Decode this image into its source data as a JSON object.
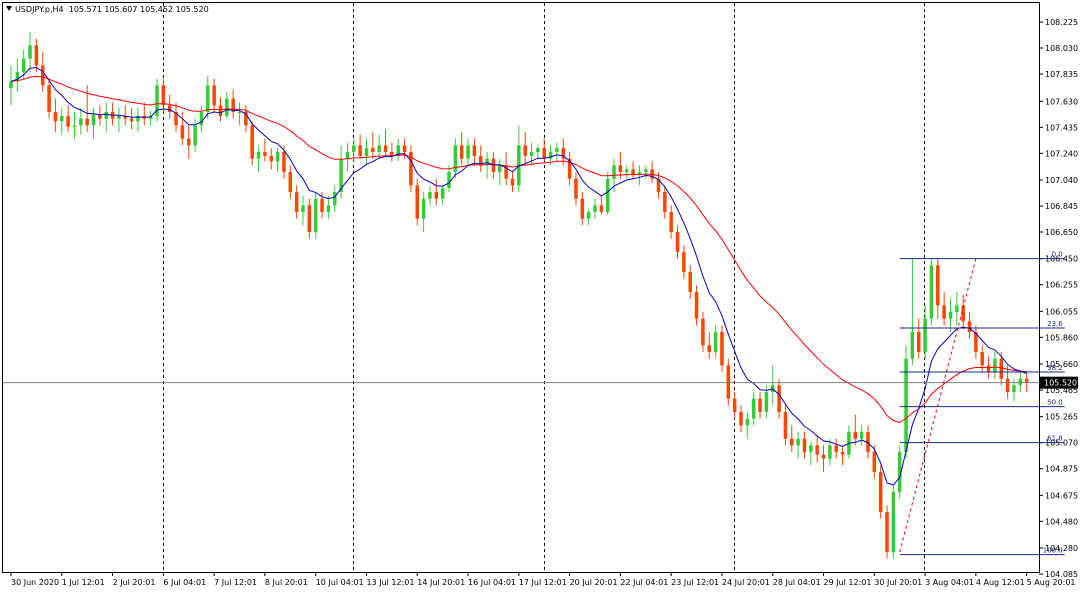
{
  "header": {
    "symbol": "USDJPY.p,H4",
    "ohlc": "105.571 105.607 105.452 105.520"
  },
  "colors": {
    "bull": "#32cd32",
    "bear": "#ff4500",
    "ma_fast": "#0000cc",
    "ma_slow": "#ff0000",
    "fib": "#1a2a8c",
    "trend": "#ff0000",
    "grid_separator": "#000000",
    "bid_line": "#808080",
    "price_tag_bg": "#000000"
  },
  "chart_data": {
    "type": "candlestick",
    "y_ticks": [
      "108.225",
      "108.030",
      "107.835",
      "107.630",
      "107.435",
      "107.240",
      "107.040",
      "106.845",
      "106.650",
      "106.450",
      "106.255",
      "106.055",
      "105.860",
      "105.660",
      "105.465",
      "105.265",
      "105.070",
      "104.875",
      "104.675",
      "104.480",
      "104.280",
      "104.085"
    ],
    "ylim": [
      104.05,
      108.28
    ],
    "x_ticks": [
      "30 Jun 2020",
      "1 Jul 12:01",
      "2 Jul 20:01",
      "6 Jul 04:01",
      "7 Jul 12:01",
      "8 Jul 20:01",
      "10 Jul 04:01",
      "13 Jul 12:01",
      "14 Jul 20:01",
      "16 Jul 04:01",
      "17 Jul 12:01",
      "20 Jul 20:01",
      "22 Jul 04:01",
      "23 Jul 12:01",
      "24 Jul 20:01",
      "28 Jul 04:01",
      "29 Jul 12:01",
      "30 Jul 20:01",
      "3 Aug 04:01",
      "4 Aug 12:01",
      "5 Aug 20:01"
    ],
    "x_tick_index": [
      0,
      8,
      16,
      24,
      32,
      40,
      48,
      56,
      64,
      72,
      80,
      88,
      96,
      104,
      112,
      120,
      128,
      136,
      144,
      152,
      160
    ],
    "day_separator_index": [
      23,
      53,
      83,
      113,
      143
    ],
    "current_price": "105.520",
    "candles": [
      [
        107.73,
        107.9,
        107.6,
        107.78
      ],
      [
        107.78,
        107.95,
        107.7,
        107.85
      ],
      [
        107.85,
        108.02,
        107.8,
        107.95
      ],
      [
        107.95,
        108.15,
        107.85,
        108.05
      ],
      [
        108.05,
        108.1,
        107.85,
        107.9
      ],
      [
        107.9,
        108.0,
        107.7,
        107.75
      ],
      [
        107.75,
        107.8,
        107.5,
        107.55
      ],
      [
        107.55,
        107.65,
        107.4,
        107.48
      ],
      [
        107.48,
        107.58,
        107.38,
        107.52
      ],
      [
        107.52,
        107.6,
        107.4,
        107.44
      ],
      [
        107.44,
        107.55,
        107.35,
        107.45
      ],
      [
        107.45,
        107.58,
        107.38,
        107.5
      ],
      [
        107.5,
        107.75,
        107.4,
        107.45
      ],
      [
        107.45,
        107.58,
        107.35,
        107.53
      ],
      [
        107.53,
        107.6,
        107.45,
        107.5
      ],
      [
        107.5,
        107.62,
        107.4,
        107.55
      ],
      [
        107.55,
        107.62,
        107.45,
        107.5
      ],
      [
        107.5,
        107.58,
        107.4,
        107.52
      ],
      [
        107.52,
        107.6,
        107.45,
        107.5
      ],
      [
        107.5,
        107.58,
        107.42,
        107.48
      ],
      [
        107.48,
        107.58,
        107.4,
        107.52
      ],
      [
        107.52,
        107.62,
        107.45,
        107.5
      ],
      [
        107.5,
        107.56,
        107.45,
        107.52
      ],
      [
        107.52,
        107.8,
        107.48,
        107.75
      ],
      [
        107.75,
        107.8,
        107.55,
        107.6
      ],
      [
        107.6,
        107.68,
        107.5,
        107.55
      ],
      [
        107.55,
        107.62,
        107.4,
        107.45
      ],
      [
        107.45,
        107.55,
        107.3,
        107.35
      ],
      [
        107.35,
        107.45,
        107.2,
        107.3
      ],
      [
        107.3,
        107.5,
        107.25,
        107.45
      ],
      [
        107.45,
        107.6,
        107.4,
        107.55
      ],
      [
        107.55,
        107.82,
        107.5,
        107.75
      ],
      [
        107.75,
        107.8,
        107.55,
        107.6
      ],
      [
        107.6,
        107.66,
        107.48,
        107.52
      ],
      [
        107.52,
        107.7,
        107.5,
        107.65
      ],
      [
        107.65,
        107.72,
        107.5,
        107.55
      ],
      [
        107.55,
        107.62,
        107.45,
        107.55
      ],
      [
        107.55,
        107.6,
        107.4,
        107.45
      ],
      [
        107.45,
        107.48,
        107.15,
        107.2
      ],
      [
        107.2,
        107.3,
        107.1,
        107.25
      ],
      [
        107.25,
        107.35,
        107.18,
        107.22
      ],
      [
        107.22,
        107.28,
        107.12,
        107.18
      ],
      [
        107.18,
        107.28,
        107.1,
        107.25
      ],
      [
        107.25,
        107.3,
        107.05,
        107.1
      ],
      [
        107.1,
        107.15,
        106.9,
        106.95
      ],
      [
        106.95,
        107.0,
        106.75,
        106.8
      ],
      [
        106.8,
        106.92,
        106.7,
        106.85
      ],
      [
        106.85,
        106.9,
        106.6,
        106.65
      ],
      [
        106.65,
        106.95,
        106.6,
        106.9
      ],
      [
        106.9,
        106.95,
        106.75,
        106.8
      ],
      [
        106.8,
        106.92,
        106.75,
        106.85
      ],
      [
        106.85,
        107.0,
        106.8,
        106.95
      ],
      [
        106.95,
        107.3,
        106.9,
        107.2
      ],
      [
        107.2,
        107.32,
        107.1,
        107.25
      ],
      [
        107.25,
        107.35,
        107.18,
        107.3
      ],
      [
        107.3,
        107.38,
        107.2,
        107.22
      ],
      [
        107.22,
        107.35,
        107.15,
        107.28
      ],
      [
        107.28,
        107.4,
        107.2,
        107.25
      ],
      [
        107.25,
        107.38,
        107.2,
        107.3
      ],
      [
        107.3,
        107.42,
        107.22,
        107.25
      ],
      [
        107.25,
        107.32,
        107.18,
        107.22
      ],
      [
        107.22,
        107.35,
        107.18,
        107.3
      ],
      [
        107.3,
        107.35,
        107.2,
        107.25
      ],
      [
        107.25,
        107.3,
        106.95,
        107.0
      ],
      [
        107.0,
        107.05,
        106.7,
        106.75
      ],
      [
        106.75,
        106.95,
        106.65,
        106.9
      ],
      [
        106.9,
        107.0,
        106.85,
        106.95
      ],
      [
        106.95,
        107.05,
        106.85,
        106.9
      ],
      [
        106.9,
        107.0,
        106.85,
        106.98
      ],
      [
        106.98,
        107.15,
        106.95,
        107.1
      ],
      [
        107.1,
        107.35,
        107.05,
        107.3
      ],
      [
        107.3,
        107.4,
        107.15,
        107.2
      ],
      [
        107.2,
        107.35,
        107.15,
        107.3
      ],
      [
        107.3,
        107.35,
        107.15,
        107.22
      ],
      [
        107.22,
        107.3,
        107.1,
        107.15
      ],
      [
        107.15,
        107.25,
        107.05,
        107.2
      ],
      [
        107.2,
        107.25,
        107.05,
        107.1
      ],
      [
        107.1,
        107.2,
        107.0,
        107.15
      ],
      [
        107.15,
        107.25,
        107.0,
        107.05
      ],
      [
        107.05,
        107.1,
        106.95,
        107.0
      ],
      [
        107.0,
        107.45,
        106.95,
        107.3
      ],
      [
        107.3,
        107.4,
        107.15,
        107.22
      ],
      [
        107.22,
        107.32,
        107.15,
        107.25
      ],
      [
        107.25,
        107.3,
        107.2,
        107.28
      ],
      [
        107.28,
        107.35,
        107.18,
        107.2
      ],
      [
        107.2,
        107.3,
        107.15,
        107.25
      ],
      [
        107.25,
        107.32,
        107.18,
        107.28
      ],
      [
        107.28,
        107.35,
        107.15,
        107.2
      ],
      [
        107.2,
        107.25,
        107.0,
        107.05
      ],
      [
        107.05,
        107.1,
        106.85,
        106.9
      ],
      [
        106.9,
        106.95,
        106.7,
        106.75
      ],
      [
        106.75,
        106.82,
        106.7,
        106.8
      ],
      [
        106.8,
        106.9,
        106.75,
        106.85
      ],
      [
        106.85,
        106.92,
        106.78,
        106.8
      ],
      [
        106.8,
        107.1,
        106.78,
        107.05
      ],
      [
        107.05,
        107.2,
        106.95,
        107.15
      ],
      [
        107.15,
        107.25,
        107.05,
        107.1
      ],
      [
        107.1,
        107.15,
        107.05,
        107.12
      ],
      [
        107.12,
        107.18,
        107.05,
        107.08
      ],
      [
        107.08,
        107.15,
        107.0,
        107.1
      ],
      [
        107.1,
        107.15,
        107.05,
        107.12
      ],
      [
        107.12,
        107.18,
        107.02,
        107.05
      ],
      [
        107.05,
        107.1,
        106.9,
        106.95
      ],
      [
        106.95,
        107.0,
        106.75,
        106.8
      ],
      [
        106.8,
        106.85,
        106.6,
        106.65
      ],
      [
        106.65,
        106.7,
        106.45,
        106.5
      ],
      [
        106.5,
        106.55,
        106.3,
        106.35
      ],
      [
        106.35,
        106.4,
        106.15,
        106.2
      ],
      [
        106.2,
        106.25,
        105.95,
        106.0
      ],
      [
        106.0,
        106.05,
        105.75,
        105.8
      ],
      [
        105.8,
        105.9,
        105.7,
        105.75
      ],
      [
        105.75,
        105.95,
        105.7,
        105.9
      ],
      [
        105.9,
        105.95,
        105.6,
        105.65
      ],
      [
        105.65,
        105.7,
        105.35,
        105.4
      ],
      [
        105.4,
        105.45,
        105.25,
        105.3
      ],
      [
        105.3,
        105.35,
        105.15,
        105.2
      ],
      [
        105.2,
        105.3,
        105.1,
        105.25
      ],
      [
        105.25,
        105.45,
        105.2,
        105.4
      ],
      [
        105.4,
        105.45,
        105.25,
        105.3
      ],
      [
        105.3,
        105.5,
        105.25,
        105.45
      ],
      [
        105.45,
        105.65,
        105.35,
        105.5
      ],
      [
        105.5,
        105.55,
        105.25,
        105.3
      ],
      [
        105.3,
        105.35,
        105.05,
        105.1
      ],
      [
        105.1,
        105.2,
        105.0,
        105.05
      ],
      [
        105.05,
        105.15,
        104.95,
        105.1
      ],
      [
        105.1,
        105.15,
        104.95,
        105.0
      ],
      [
        105.0,
        105.08,
        104.9,
        105.05
      ],
      [
        105.05,
        105.12,
        104.92,
        104.98
      ],
      [
        104.98,
        105.05,
        104.85,
        104.95
      ],
      [
        104.95,
        105.1,
        104.9,
        105.05
      ],
      [
        105.05,
        105.1,
        104.95,
        105.0
      ],
      [
        105.0,
        105.05,
        104.9,
        104.98
      ],
      [
        104.98,
        105.2,
        104.95,
        105.15
      ],
      [
        105.15,
        105.28,
        105.05,
        105.1
      ],
      [
        105.1,
        105.2,
        105.05,
        105.15
      ],
      [
        105.15,
        105.2,
        104.95,
        105.0
      ],
      [
        105.0,
        105.05,
        104.8,
        104.85
      ],
      [
        104.85,
        104.9,
        104.5,
        104.55
      ],
      [
        104.55,
        104.6,
        104.2,
        104.25
      ],
      [
        104.25,
        104.75,
        104.2,
        104.7
      ],
      [
        104.7,
        105.05,
        104.65,
        105.0
      ],
      [
        105.0,
        105.8,
        104.95,
        105.7
      ],
      [
        105.7,
        106.45,
        105.65,
        105.9
      ],
      [
        105.9,
        106.0,
        105.7,
        105.75
      ],
      [
        105.75,
        106.1,
        105.7,
        106.0
      ],
      [
        106.0,
        106.45,
        105.95,
        106.4
      ],
      [
        106.4,
        106.45,
        106.0,
        106.1
      ],
      [
        106.1,
        106.2,
        105.95,
        106.0
      ],
      [
        106.0,
        106.15,
        105.9,
        106.05
      ],
      [
        106.05,
        106.2,
        105.95,
        106.1
      ],
      [
        106.1,
        106.18,
        105.92,
        105.98
      ],
      [
        105.98,
        106.05,
        105.85,
        105.9
      ],
      [
        105.9,
        105.95,
        105.7,
        105.75
      ],
      [
        105.75,
        105.8,
        105.6,
        105.65
      ],
      [
        105.65,
        105.72,
        105.55,
        105.6
      ],
      [
        105.6,
        105.75,
        105.55,
        105.7
      ],
      [
        105.7,
        105.75,
        105.5,
        105.55
      ],
      [
        105.55,
        105.65,
        105.4,
        105.45
      ],
      [
        105.45,
        105.55,
        105.38,
        105.5
      ],
      [
        105.5,
        105.6,
        105.45,
        105.55
      ],
      [
        105.55,
        105.61,
        105.45,
        105.52
      ]
    ],
    "fib_levels": [
      {
        "label": "0.0",
        "price": 106.45
      },
      {
        "label": "23.6",
        "price": 105.93
      },
      {
        "label": "38.2",
        "price": 105.6
      },
      {
        "label": "50.0",
        "price": 105.34
      },
      {
        "label": "61.8",
        "price": 105.07
      },
      {
        "label": "100.0",
        "price": 104.23
      }
    ],
    "fib_range_index": [
      140,
      166
    ],
    "trendline": [
      [
        140,
        104.25
      ],
      [
        152,
        106.45
      ]
    ]
  }
}
